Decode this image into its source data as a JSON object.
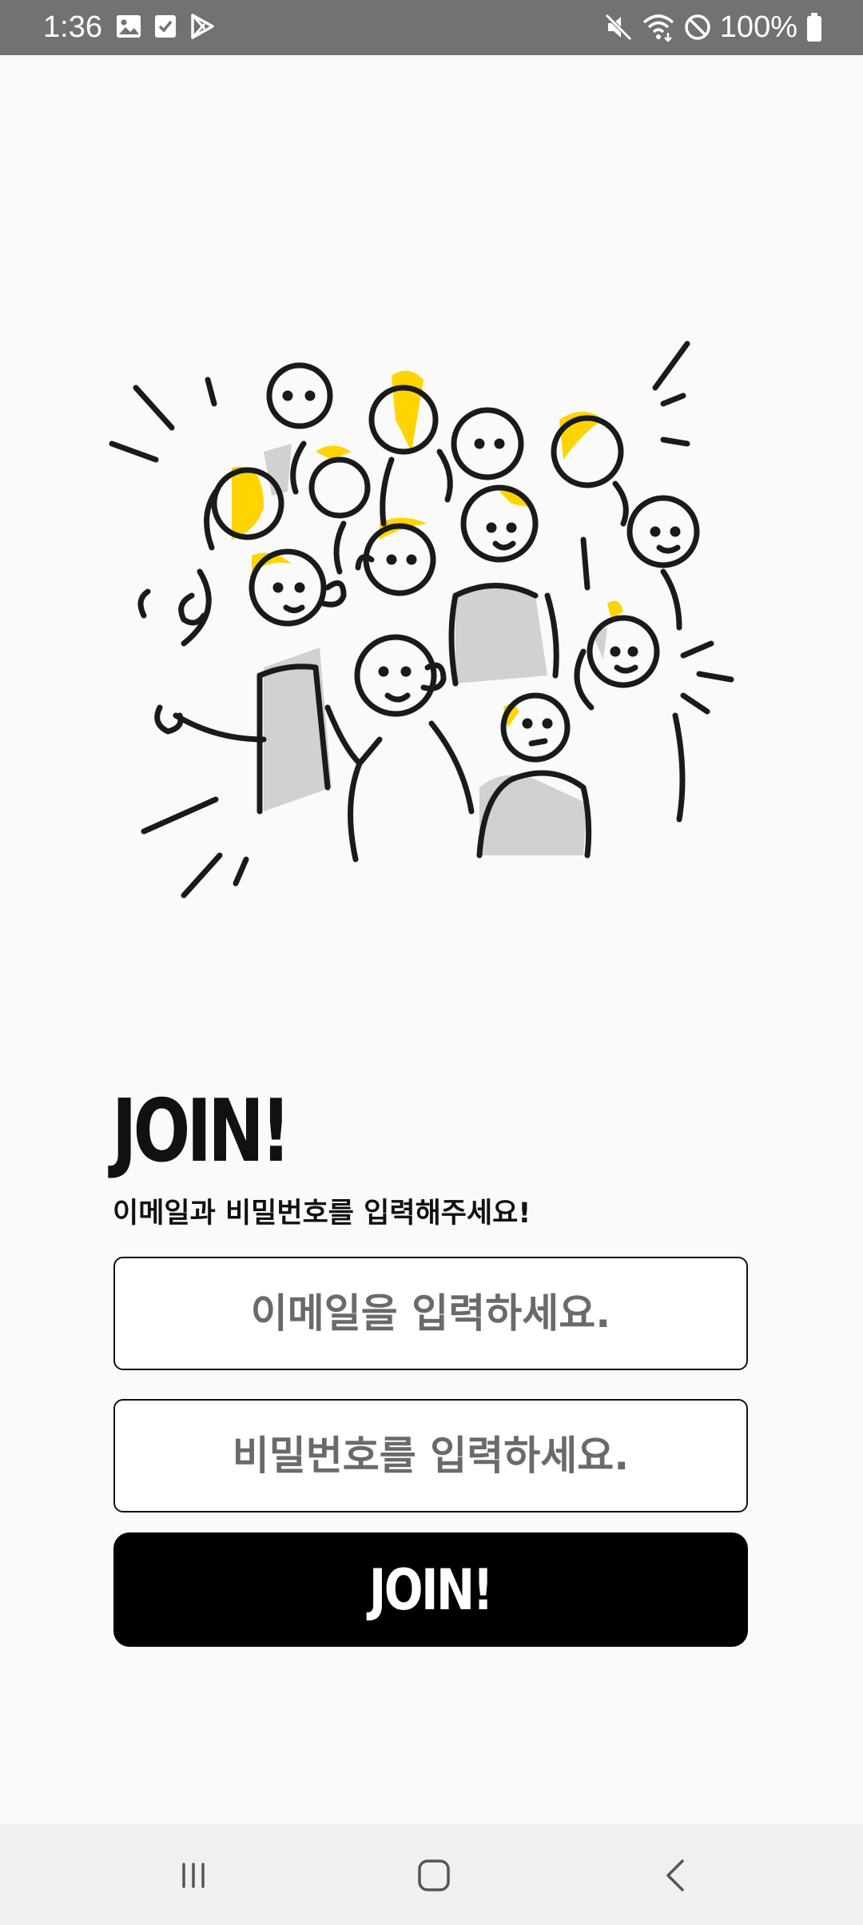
{
  "status_bar": {
    "time": "1:36",
    "battery_text": "100%",
    "left_icons": [
      "image-icon",
      "checkbox-icon",
      "play-store-icon"
    ],
    "right_icons": [
      "mute-icon",
      "wifi-icon",
      "do-not-disturb-icon",
      "battery-icon"
    ]
  },
  "illustration": {
    "description_icon": "crowd-illustration",
    "accent_color": "#FFD400",
    "fill_gray": "#d0d1d3",
    "line_color": "#1a1a1a"
  },
  "join": {
    "title": "JOIN!",
    "subtitle": "이메일과 비밀번호를 입력해주세요!",
    "email_placeholder": "이메일을 입력하세요.",
    "password_placeholder": "비밀번호를 입력하세요.",
    "button_label": "JOIN!"
  },
  "nav_bar": {
    "buttons": [
      "recents-icon",
      "home-icon",
      "back-icon"
    ]
  }
}
